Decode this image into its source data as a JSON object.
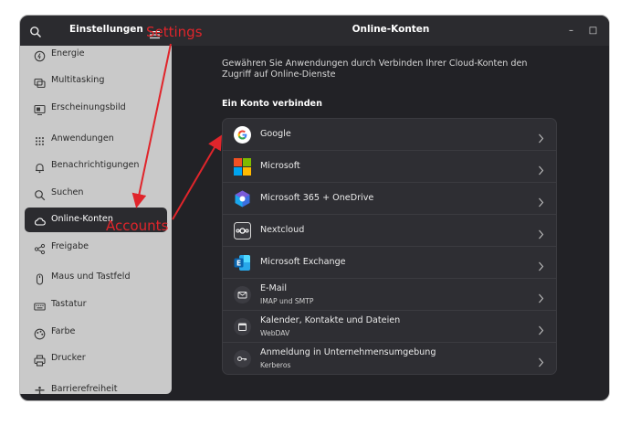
{
  "sidebar": {
    "title": "Einstellungen",
    "items": [
      {
        "label": "Energie",
        "icon": "power-icon",
        "active": false
      },
      {
        "label": "Multitasking",
        "icon": "multitasking-icon",
        "active": false
      },
      {
        "label": "Erscheinungsbild",
        "icon": "appearance-icon",
        "active": false
      },
      {
        "label": "Anwendungen",
        "icon": "apps-grid-icon",
        "active": false
      },
      {
        "label": "Benachrichtigungen",
        "icon": "bell-icon",
        "active": false
      },
      {
        "label": "Suchen",
        "icon": "search-icon",
        "active": false
      },
      {
        "label": "Online-Konten",
        "icon": "cloud-icon",
        "active": true
      },
      {
        "label": "Freigabe",
        "icon": "share-icon",
        "active": false
      },
      {
        "label": "Maus und Tastfeld",
        "icon": "mouse-icon",
        "active": false
      },
      {
        "label": "Tastatur",
        "icon": "keyboard-icon",
        "active": false
      },
      {
        "label": "Farbe",
        "icon": "color-icon",
        "active": false
      },
      {
        "label": "Drucker",
        "icon": "printer-icon",
        "active": false
      },
      {
        "label": "Barrierefreiheit",
        "icon": "accessibility-icon",
        "active": false
      }
    ]
  },
  "main": {
    "title": "Online-Konten",
    "intro": "Gewähren Sie Anwendungen durch Verbinden Ihrer Cloud-Konten den Zugriff auf Online-Dienste",
    "section_title": "Ein Konto verbinden",
    "accounts": [
      {
        "name": "Google",
        "subtitle": "",
        "icon": "google-icon"
      },
      {
        "name": "Microsoft",
        "subtitle": "",
        "icon": "microsoft-icon"
      },
      {
        "name": "Microsoft 365 + OneDrive",
        "subtitle": "",
        "icon": "microsoft-365-icon"
      },
      {
        "name": "Nextcloud",
        "subtitle": "",
        "icon": "nextcloud-icon"
      },
      {
        "name": "Microsoft Exchange",
        "subtitle": "",
        "icon": "exchange-icon"
      },
      {
        "name": "E-Mail",
        "subtitle": "IMAP und SMTP",
        "icon": "mail-icon"
      },
      {
        "name": "Kalender, Kontakte und Dateien",
        "subtitle": "WebDAV",
        "icon": "calendar-icon"
      },
      {
        "name": "Anmeldung in Unternehmensumgebung",
        "subtitle": "Kerberos",
        "icon": "key-icon"
      }
    ]
  },
  "window_controls": {
    "minimize": "–",
    "maximize": "□",
    "close": "✕"
  },
  "annotations": {
    "settings": "Settings",
    "accounts": "Accounts"
  },
  "colors": {
    "annotation": "#e0252b",
    "sidebar_bg": "#c9c9c9",
    "window_bg": "#222226",
    "header_bg": "#2b2b2f"
  }
}
